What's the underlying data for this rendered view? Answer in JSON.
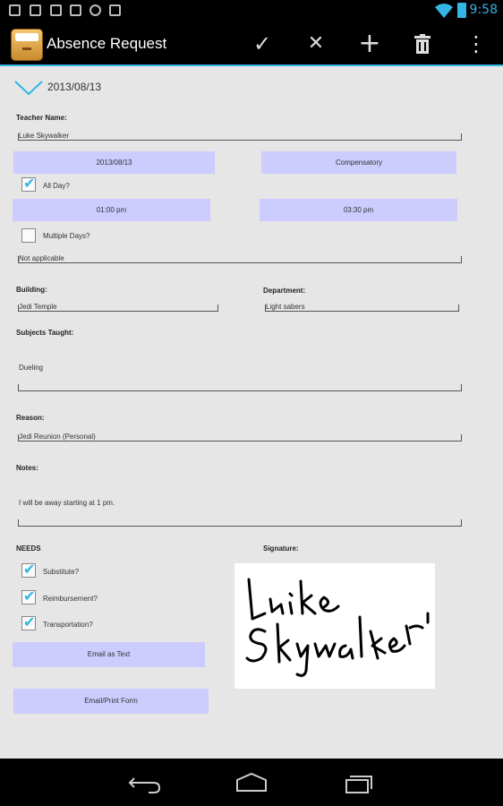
{
  "status_bar": {
    "time": "9:58",
    "accent_color": "#33b5e5"
  },
  "action_bar": {
    "title": "Absence Request",
    "actions": [
      {
        "icon": "checkmark-icon",
        "glyph": "✓"
      },
      {
        "icon": "close-icon",
        "glyph": "✕"
      },
      {
        "icon": "plus-icon",
        "glyph": "+"
      },
      {
        "icon": "trash-icon",
        "glyph": "🗑"
      },
      {
        "icon": "overflow-menu-icon",
        "glyph": "⋮"
      }
    ]
  },
  "header": {
    "date": "2013/08/13"
  },
  "form": {
    "teacher_name_label": "Teacher Name:",
    "teacher_name_value": "Luke Skywalker",
    "date_button": "2013/08/13",
    "type_button": "Compensatory",
    "all_day_label": "All Day?",
    "all_day_checked": true,
    "start_time_button": "01:00 pm",
    "end_time_button": "03:30 pm",
    "multiple_days_label": "Multiple Days?",
    "multiple_days_checked": false,
    "multiple_days_value": "Not applicable",
    "building_label": "Building:",
    "building_value": "Jedi Temple",
    "department_label": "Department:",
    "department_value": "Light sabers",
    "subjects_label": "Subjects Taught:",
    "subjects_value": "Dueling",
    "reason_label": "Reason:",
    "reason_value": "Jedi Reunion (Personal)",
    "notes_label": "Notes:",
    "notes_value": "I will be away starting at 1 pm.",
    "needs_label": "NEEDS",
    "substitute_label": "Substitute?",
    "substitute_checked": true,
    "reimbursement_label": "Reimbursement?",
    "reimbursement_checked": true,
    "transportation_label": "Transportation?",
    "transportation_checked": true,
    "signature_label": "Signature:",
    "email_text_button": "Email as Text",
    "email_print_button": "Email/Print Form",
    "button_color": "#ccccff"
  }
}
